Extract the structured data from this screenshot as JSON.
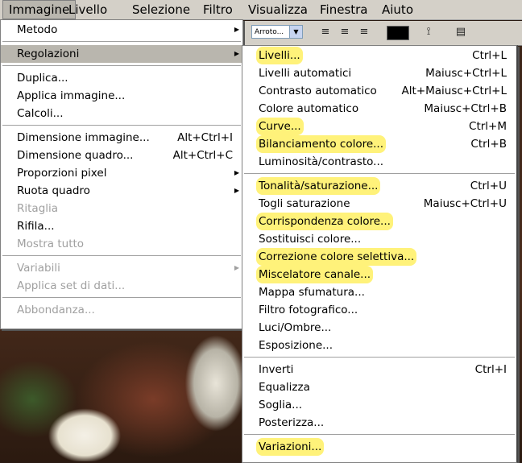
{
  "menubar": {
    "items": [
      "Immagine",
      "Livello",
      "Selezione",
      "Filtro",
      "Visualizza",
      "Finestra",
      "Aiuto"
    ],
    "active": "Immagine"
  },
  "toolbar": {
    "select_value": "Arroto...",
    "swatch_color": "#000000"
  },
  "image_menu": [
    {
      "label": "Metodo",
      "submenu": true
    },
    {
      "separator": true
    },
    {
      "label": "Regolazioni",
      "submenu": true,
      "hover": true
    },
    {
      "separator": true
    },
    {
      "label": "Duplica..."
    },
    {
      "label": "Applica immagine..."
    },
    {
      "label": "Calcoli..."
    },
    {
      "separator": true
    },
    {
      "label": "Dimensione immagine...",
      "shortcut": "Alt+Ctrl+I"
    },
    {
      "label": "Dimensione quadro...",
      "shortcut": "Alt+Ctrl+C"
    },
    {
      "label": "Proporzioni pixel",
      "submenu": true
    },
    {
      "label": "Ruota quadro",
      "submenu": true
    },
    {
      "label": "Ritaglia",
      "disabled": true
    },
    {
      "label": "Rifila..."
    },
    {
      "label": "Mostra tutto",
      "disabled": true
    },
    {
      "separator": true
    },
    {
      "label": "Variabili",
      "submenu": true,
      "disabled": true
    },
    {
      "label": "Applica set di dati...",
      "disabled": true
    },
    {
      "separator": true
    },
    {
      "label": "Abbondanza...",
      "disabled": true
    }
  ],
  "adjust_menu": [
    {
      "label": "Livelli...",
      "shortcut": "Ctrl+L",
      "highlight": true
    },
    {
      "label": "Livelli automatici",
      "shortcut": "Maiusc+Ctrl+L"
    },
    {
      "label": "Contrasto automatico",
      "shortcut": "Alt+Maiusc+Ctrl+L"
    },
    {
      "label": "Colore automatico",
      "shortcut": "Maiusc+Ctrl+B"
    },
    {
      "label": "Curve...",
      "shortcut": "Ctrl+M",
      "highlight": true
    },
    {
      "label": "Bilanciamento colore...",
      "shortcut": "Ctrl+B",
      "highlight": true
    },
    {
      "label": "Luminosità/contrasto..."
    },
    {
      "separator": true
    },
    {
      "label": "Tonalità/saturazione...",
      "shortcut": "Ctrl+U",
      "highlight": true
    },
    {
      "label": "Togli saturazione",
      "shortcut": "Maiusc+Ctrl+U"
    },
    {
      "label": "Corrispondenza colore...",
      "highlight": true
    },
    {
      "label": "Sostituisci colore..."
    },
    {
      "label": "Correzione colore selettiva...",
      "highlight": true
    },
    {
      "label": "Miscelatore canale...",
      "highlight": true
    },
    {
      "label": "Mappa sfumatura..."
    },
    {
      "label": "Filtro fotografico..."
    },
    {
      "label": "Luci/Ombre..."
    },
    {
      "label": "Esposizione..."
    },
    {
      "separator": true
    },
    {
      "label": "Inverti",
      "shortcut": "Ctrl+I"
    },
    {
      "label": "Equalizza"
    },
    {
      "label": "Soglia..."
    },
    {
      "label": "Posterizza..."
    },
    {
      "separator": true
    },
    {
      "label": "Variazioni...",
      "highlight": true
    }
  ],
  "colors": {
    "menu_bg": "#ffffff",
    "menubar_bg": "#d4d0c8",
    "hover_bg": "#b9b6ae",
    "highlight_marker": "#fff27a",
    "disabled_text": "#a0a0a0"
  }
}
